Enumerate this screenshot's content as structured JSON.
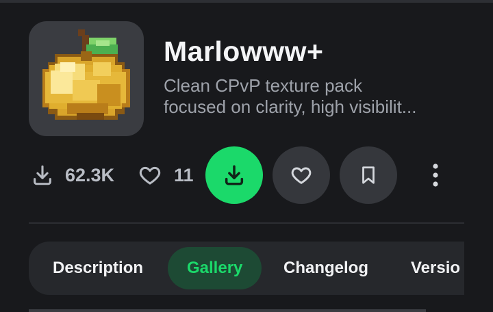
{
  "project": {
    "title": "Marlowww+",
    "description_line1": "Clean CPvP texture pack",
    "description_line2": "focused on clarity, high visibilit..."
  },
  "stats": {
    "downloads": "62.3K",
    "likes": "11"
  },
  "tabs": [
    {
      "label": "Description"
    },
    {
      "label": "Gallery",
      "active": true
    },
    {
      "label": "Changelog"
    },
    {
      "label": "Versio"
    }
  ],
  "icons": {
    "project": "golden-apple-icon",
    "downloads": "download-icon",
    "likes": "heart-icon",
    "download_button": "download-icon",
    "follow_button": "heart-icon",
    "save_button": "bookmark-icon",
    "more": "kebab-menu-icon"
  },
  "colors": {
    "background": "#18191c",
    "accent": "#1bd96a",
    "button": "#35373c",
    "tabs_bar": "#26282c",
    "active_tab_bg": "#1d4a34"
  }
}
